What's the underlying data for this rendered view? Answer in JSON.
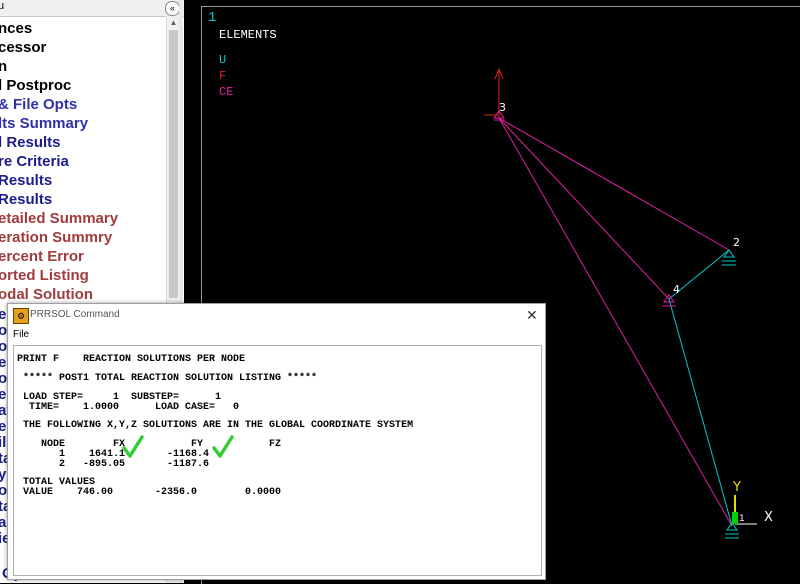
{
  "menu": {
    "title": "u",
    "collapse_glyph": "«",
    "items": [
      {
        "label": "nces",
        "color": "#000000"
      },
      {
        "label": "cessor",
        "color": "#000000"
      },
      {
        "label": "n",
        "color": "#000000"
      },
      {
        "label": "l Postproc",
        "color": "#000000"
      },
      {
        "label": " & File Opts",
        "color": "#3030a8"
      },
      {
        "label": "lts Summary",
        "color": "#3030a8"
      },
      {
        "label": "l Results",
        "color": "#1c1c8c"
      },
      {
        "label": "re Criteria",
        "color": "#1c1c8c"
      },
      {
        "label": " Results",
        "color": "#1c1c8c"
      },
      {
        "label": "Results",
        "color": "#1c1c8c"
      },
      {
        "label": "etailed Summary",
        "color": "#a03c3c"
      },
      {
        "label": "eration Summry",
        "color": "#a03c3c"
      },
      {
        "label": "ercent Error",
        "color": "#a03c3c"
      },
      {
        "label": "orted Listing",
        "color": "#a03c3c"
      },
      {
        "label": "odal Solution",
        "color": "#a03c3c"
      }
    ],
    "behind_dialog": [
      "e",
      "ou",
      "od",
      "ea",
      "oc",
      "ed",
      "at",
      "ec",
      "il",
      "ta",
      "y",
      "o",
      "ta",
      "al",
      "ie"
    ],
    "bottom_item": "Operations"
  },
  "graphics": {
    "window_number": "1",
    "header": "ELEMENTS",
    "legend": [
      {
        "label": "U",
        "color": "#00c8c8"
      },
      {
        "label": "F",
        "color": "#e02020"
      },
      {
        "label": "CE",
        "color": "#e020a0"
      }
    ],
    "nodes": [
      "3",
      "2",
      "4",
      "1"
    ],
    "axis_x": "X",
    "axis_y": "Y"
  },
  "dialog": {
    "icon": "⚙",
    "title": "PRRSOL   Command",
    "close": "✕",
    "menu_file": "File",
    "output": {
      "line1": "PRINT F    REACTION SOLUTIONS PER NODE",
      "line2": " ***** POST1 TOTAL REACTION SOLUTION LISTING *****",
      "line3": " LOAD STEP=     1  SUBSTEP=      1",
      "line4": "  TIME=    1.0000      LOAD CASE=   0",
      "line5": " THE FOLLOWING X,Y,Z SOLUTIONS ARE IN THE GLOBAL COORDINATE SYSTEM",
      "line6": "    NODE        FX           FY           FZ",
      "line7": "       1    1641.1       -1168.4",
      "line8": "       2   -895.05       -1187.6",
      "line9": " TOTAL VALUES",
      "line10": " VALUE    746.00       -2356.0        0.0000"
    },
    "check_color": "#33cc33"
  }
}
